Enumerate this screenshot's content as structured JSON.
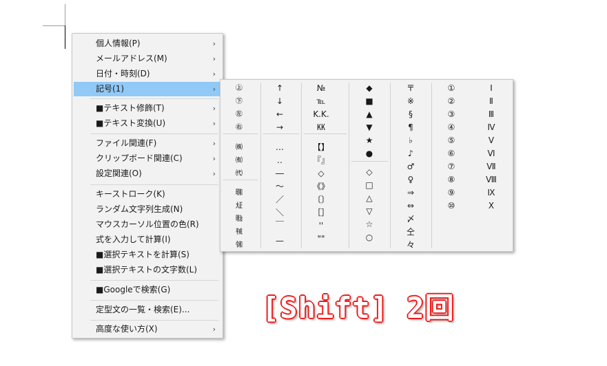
{
  "menu": {
    "items": [
      {
        "label": "個人情報(P)",
        "arrow": "›"
      },
      {
        "label": "メールアドレス(M)",
        "arrow": "›"
      },
      {
        "label": "日付・時刻(D)",
        "arrow": "›"
      },
      {
        "label": "記号(1)",
        "arrow": "›"
      },
      {
        "label": "■テキスト修飾(T)",
        "arrow": "›"
      },
      {
        "label": "■テキスト変換(U)",
        "arrow": "›"
      },
      {
        "label": "ファイル関連(F)",
        "arrow": "›"
      },
      {
        "label": "クリップボード関連(C)",
        "arrow": "›"
      },
      {
        "label": "設定関連(O)",
        "arrow": "›"
      },
      {
        "label": "キーストローク(K)"
      },
      {
        "label": "ランダム文字列生成(N)"
      },
      {
        "label": "マウスカーソル位置の色(R)"
      },
      {
        "label": "式を入力して計算(I)"
      },
      {
        "label": "■選択テキストを計算(S)"
      },
      {
        "label": "■選択テキストの文字数(L)"
      },
      {
        "label": "■Googleで検索(G)"
      },
      {
        "label": "定型文の一覧・検索(E)..."
      },
      {
        "label": "高度な使い方(X)",
        "arrow": "›"
      }
    ]
  },
  "symbols": {
    "col1": [
      "㊤",
      "㊦",
      "㊧",
      "㊨",
      "㈱",
      "㈲",
      "㈹",
      "㍼",
      "㍽",
      "㍾",
      "㍻",
      "㋿"
    ],
    "col2": [
      "↑",
      "↓",
      "←",
      "→",
      "…",
      "‥",
      "―",
      "〜",
      "／",
      "＼",
      "￣",
      "—"
    ],
    "col3": [
      "№",
      "℡",
      "K.K.",
      "㏍",
      "【】",
      "『』",
      "◇",
      "《》",
      "〔〕",
      "［］",
      "''",
      "\"\""
    ],
    "col4": [
      "◆",
      "■",
      "▲",
      "▼",
      "★",
      "●",
      "◇",
      "□",
      "△",
      "▽",
      "☆",
      "○"
    ],
    "col5": [
      "〒",
      "※",
      "§",
      "¶",
      "♭",
      "♪",
      "♂",
      "♀",
      "⇒",
      "⇔",
      "〆",
      "仝",
      "々"
    ],
    "col6": [
      "①",
      "②",
      "③",
      "④",
      "⑤",
      "⑥",
      "⑦",
      "⑧",
      "⑨",
      "⑩"
    ],
    "col7": [
      "Ⅰ",
      "Ⅱ",
      "Ⅲ",
      "Ⅳ",
      "Ⅴ",
      "Ⅵ",
      "Ⅶ",
      "Ⅷ",
      "Ⅸ",
      "Ⅹ"
    ]
  },
  "caption": "[Shift] 2回",
  "colors": {
    "highlight": "#91c9f7",
    "caption_outline": "#ee1c1c"
  }
}
